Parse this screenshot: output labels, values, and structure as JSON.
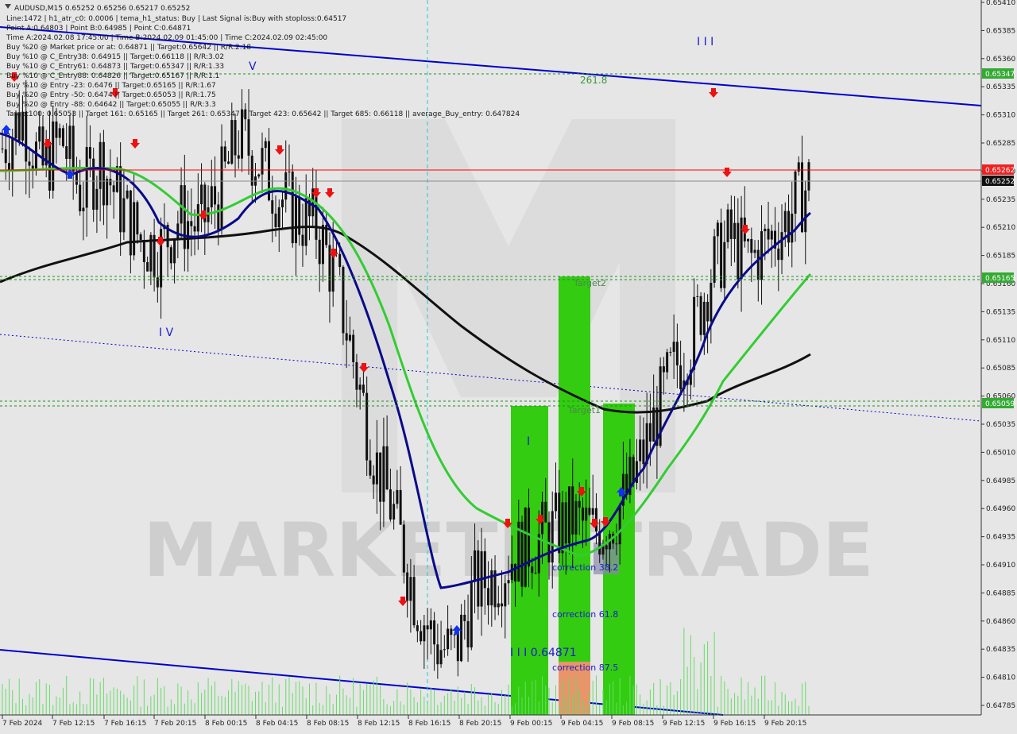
{
  "header": {
    "symbol": "AUDUSD,M15  0.65252 0.65256 0.65217 0.65252",
    "lines": [
      "Line:1472 | h1_atr_c0: 0.0006 | tema_h1_status: Buy | Last Signal is:Buy with stoploss:0.64517",
      "Point A:0.64803 | Point B:0.64985 | Point C:0.64871",
      "Time A:2024.02.08 17:45:00 | Time B:2024.02.09 01:45:00 | Time C:2024.02.09 02:45:00",
      "Buy %20 @ Market price or at: 0.64871 || Target:0.65642 || R/R:2.18",
      "Buy %10 @ C_Entry38: 0.64915 || Target:0.66118 || R/R:3.02",
      "Buy %10 @ C_Entry61: 0.64873 || Target:0.65347 || R/R:1.33",
      "Buy %10 @ C_Entry88: 0.64826 || Target:0.65167 || R/R:1.1",
      "Buy %10 @ Entry -23: 0.6476 || Target:0.65165 || R/R:1.67",
      "Buy %20 @ Entry -50: 0.6474 || Target:0.65053 || R/R:1.75",
      "Buy %20 @ Entry -88: 0.64642 || Target:0.65055 || R/R:3.3",
      "Target100: 0.65053 || Target 161: 0.65165 || Target 261: 0.65347 || Target 423: 0.65642 || Target 685: 0.66118 || average_Buy_entry: 0.647824"
    ]
  },
  "watermark": "MARKETIQTRADE",
  "labels": {
    "fib_261": "261.8",
    "target2": "Target2",
    "target1": "Target1",
    "wave_III_top": "I I I",
    "wave_V": "V",
    "wave_IV": "I V",
    "wave_I": "I",
    "wave_III_value": "I I I 0.64871",
    "correction_38": "correction 38.2",
    "correction_61": "correction 61.8",
    "correction_87": "correction 87.5"
  },
  "price_tags": {
    "t65347": "0.65347",
    "t65262": "0.65262",
    "t65252": "0.65252",
    "t65165": "0.65165",
    "t65059": "0.65059"
  },
  "colors": {
    "background": "#e6e6e6",
    "red_line": "#ff0000",
    "green_zone": "#33cc11",
    "orange_zone": "#e8956a",
    "channel": "#0000cc",
    "ma_black": "#111111",
    "ma_navy": "#0a0a8a",
    "ma_green": "#33cc33"
  },
  "chart_data": {
    "type": "candlestick",
    "symbol": "AUDUSD",
    "timeframe": "M15",
    "ylim": [
      0.6478,
      0.6541
    ],
    "y_ticks": [
      "0.65410",
      "0.65385",
      "0.65360",
      "0.65335",
      "0.65310",
      "0.65285",
      "0.65260",
      "0.65235",
      "0.65210",
      "0.65185",
      "0.65160",
      "0.65135",
      "0.65110",
      "0.65085",
      "0.65060",
      "0.65035",
      "0.65010",
      "0.64985",
      "0.64960",
      "0.64935",
      "0.64910",
      "0.64885",
      "0.64860",
      "0.64835",
      "0.64810",
      "0.64785"
    ],
    "x_ticks": [
      "7 Feb 2024",
      "7 Feb 12:15",
      "7 Feb 16:15",
      "7 Feb 20:15",
      "8 Feb 00:15",
      "8 Feb 04:15",
      "8 Feb 08:15",
      "8 Feb 12:15",
      "8 Feb 16:15",
      "8 Feb 20:15",
      "9 Feb 00:15",
      "9 Feb 04:15",
      "9 Feb 08:15",
      "9 Feb 12:15",
      "9 Feb 16:15",
      "9 Feb 20:15"
    ],
    "close_path": [
      0.6528,
      0.6531,
      0.6526,
      0.6529,
      0.6524,
      0.6527,
      0.6523,
      0.652,
      0.6519,
      0.6522,
      0.6521,
      0.6524,
      0.6529,
      0.6527,
      0.6524,
      0.6522,
      0.6521,
      0.6516,
      0.6508,
      0.65,
      0.6495,
      0.6488,
      0.6484,
      0.6483,
      0.6489,
      0.649,
      0.6492,
      0.6493,
      0.6494,
      0.6495,
      0.6494,
      0.6495,
      0.6498,
      0.6503,
      0.6508,
      0.6511,
      0.6517,
      0.652,
      0.6518,
      0.652,
      0.6522,
      0.6525
    ],
    "horizontal_levels": [
      {
        "value": 0.65347,
        "style": "green-dotted"
      },
      {
        "value": 0.65262,
        "style": "red-solid"
      },
      {
        "value": 0.65252,
        "style": "grey-solid"
      },
      {
        "value": 0.65165,
        "style": "green-dotted"
      },
      {
        "value": 0.65059,
        "style": "green-dotted"
      }
    ]
  }
}
